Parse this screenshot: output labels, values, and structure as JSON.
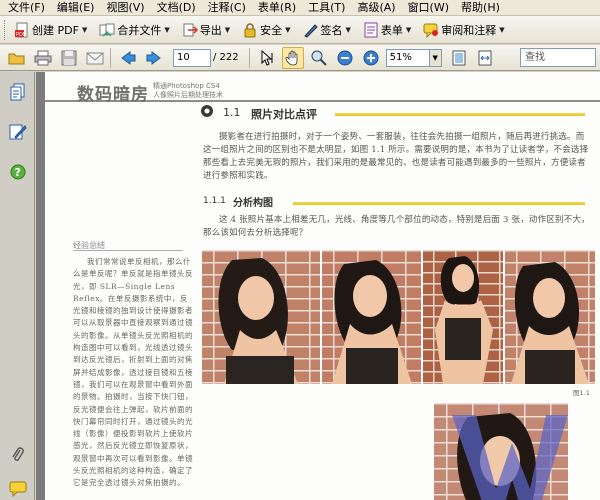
{
  "menu": [
    "文件(F)",
    "编辑(E)",
    "视图(V)",
    "文档(D)",
    "注释(C)",
    "表单(R)",
    "工具(T)",
    "高级(A)",
    "窗口(W)",
    "帮助(H)"
  ],
  "toolbar1": {
    "create_pdf": "创建 PDF",
    "combine": "合并文件",
    "export": "导出",
    "security": "安全",
    "sign": "签名",
    "forms": "表单",
    "review": "审阅和注释"
  },
  "toolbar2": {
    "current_page": "10",
    "total_pages": "/ 222",
    "zoom": "51%",
    "search_placeholder": "查找"
  },
  "page": {
    "header_title": "数码暗房",
    "header_sub1": "精通Photoshop CS4",
    "header_sub2": "人像照片后期处理技术",
    "section_number": "1.1",
    "section_title": "照片对比点评",
    "paragraph1": "摄影者在进行拍摄时，对于一个姿势、一套服装，往往会先拍摄一组照片，随后再进行挑选。而这一组照片之间的区别也不是太明显，如图 1.1 所示。需要说明的是，本书为了让读者学，不会选择那些看上去完美无瑕的照片，我们采用的是最常见的、也是读者可能遇到最多的一些照片，方便读者进行参照和实践。",
    "subsection_number": "1.1.1",
    "subsection_title": "分析构图",
    "paragraph2": "这 4 张照片基本上相差无几，光线、角度等几个部位的动态，特别是后面 3 张，动作区别不大，那么该如何去分析选择呢？",
    "side_label": "经验总结",
    "side_text": "我们常常说单反相机，那么什么是单反呢？单反就是指单镜头反光，即 SLR—Single Lens Reflex。在单反摄影系统中，反光镜和棱镜的独到设计使得摄影者可以从取景器中直接观察到通过镜头的影像。从单镜头反光照相机的构造图中可以看到，光线透过镜头到达反光镜后，折射到上面的对焦屏并结成影像，透过接目镜和五棱镜，我们可以在观景窗中看到外面的景物。拍摄时，当按下快门钮，反光镜便会往上弹起，软片前面的快门幕帘同时打开，通过镜头的光线（影像）便投影到软片上使软片感光，然后反光镜立即恢复原状，观景窗中再次可以看到影像。单镜头反光照相机的这种构造，确定了它是完全透过镜头对焦拍摄的。",
    "figure_caption": "图1.1"
  },
  "colors": {
    "accent_yellow": "#eac22d",
    "doc_background": "#7c7c7c",
    "chrome": "#ece9d8"
  },
  "icons": {
    "toolbar1": [
      "create-pdf-icon",
      "combine-icon",
      "export-icon",
      "security-lock-icon",
      "sign-pen-icon",
      "forms-icon",
      "review-comment-icon"
    ],
    "toolbar2": [
      "open-folder-icon",
      "print-icon",
      "save-disk-icon",
      "email-icon",
      "prev-page-icon",
      "next-page-icon",
      "select-text-icon",
      "hand-tool-icon",
      "zoom-marquee-icon",
      "zoom-out-icon",
      "zoom-in-icon",
      "fit-page-icon",
      "fit-width-icon"
    ],
    "nav": [
      "pages-icon",
      "signatures-icon",
      "help-icon",
      "attachments-icon",
      "comments-icon"
    ]
  }
}
